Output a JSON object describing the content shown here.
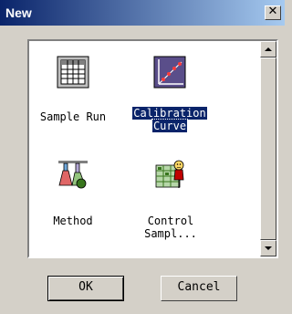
{
  "window": {
    "title": "New"
  },
  "items": [
    {
      "label": "Sample Run",
      "icon": "grid-table-icon",
      "selected": false
    },
    {
      "label_line1": "Calibration",
      "label_line2": "Curve",
      "icon": "calibration-curve-icon",
      "selected": true
    },
    {
      "label": "Method",
      "icon": "lab-flasks-icon",
      "selected": false
    },
    {
      "label_line1": "Control",
      "label_line2": "Sampl...",
      "icon": "control-sample-icon",
      "selected": false
    }
  ],
  "buttons": {
    "ok": "OK",
    "cancel": "Cancel"
  },
  "colors": {
    "selection": "#0a246a",
    "face": "#d4d0c8",
    "title_start": "#0a246a",
    "title_end": "#a6caf0"
  }
}
